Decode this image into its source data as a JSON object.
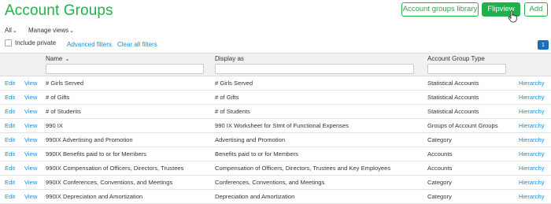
{
  "page": {
    "title": "Account Groups"
  },
  "toolbar": {
    "groups_library": "Account groups library",
    "flipview": "Flipview",
    "add": "Add"
  },
  "filters": {
    "view_select": "All",
    "manage_views": "Manage views",
    "include_private": "Include private",
    "advanced_filters": "Advanced filters",
    "clear_all_filters": "Clear all filters",
    "page_number": "1"
  },
  "table": {
    "columns": {
      "name": "Name",
      "display_as": "Display as",
      "type": "Account Group Type"
    },
    "action_edit": "Edit",
    "action_view": "View",
    "action_hierarchy": "Hierarchy",
    "rows": [
      {
        "name": "# Girls Served",
        "display": "# Girls Served",
        "type": "Statistical Accounts"
      },
      {
        "name": "# of Gifts",
        "display": "# of Gifts",
        "type": "Statistical Accounts"
      },
      {
        "name": "# of Students",
        "display": "# of Students",
        "type": "Statistical Accounts"
      },
      {
        "name": "990 IX",
        "display": "990 IX Worksheet for Stmt of Functional Expenses",
        "type": "Groups of Account Groups"
      },
      {
        "name": "990IX Advertising and Promotion",
        "display": "Advertising and Promotion",
        "type": "Category"
      },
      {
        "name": "990IX Benefits paid to or for Members",
        "display": "Benefits paid to or for Members",
        "type": "Accounts"
      },
      {
        "name": "990IX Compensation of Officers, Directors, Trustees",
        "display": "Compensation of Officers, Directors, Trustees and Key Employees",
        "type": "Accounts"
      },
      {
        "name": "990IX Conferences, Conventions, and Meetings",
        "display": "Conferences, Conventions, and Meetings",
        "type": "Category"
      },
      {
        "name": "990IX Depreciation and Amortization",
        "display": "Depreciation and Amortization",
        "type": "Category"
      }
    ]
  },
  "colors": {
    "accent": "#21b04b",
    "link": "#1a8fd6",
    "pager": "#1a6fbd"
  }
}
